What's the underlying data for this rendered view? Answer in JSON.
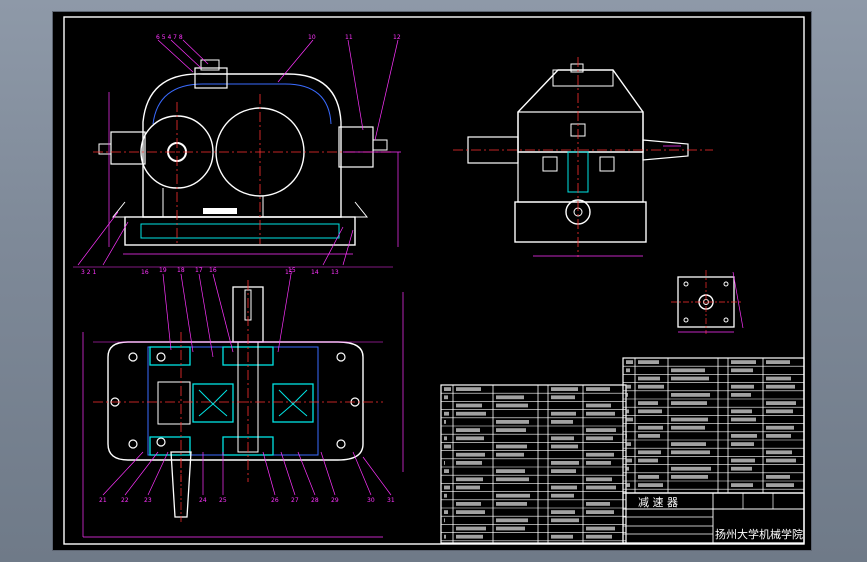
{
  "title_block": {
    "product_name": "减 速 器",
    "institution": "扬州大学机械学院"
  },
  "balloons": {
    "front_top_group": "6 5 4 7 8",
    "front_top_a": "10",
    "front_top_b": "11",
    "front_top_c": "12",
    "front_bottom_left": "3 2 1",
    "front_bottom_a": "16",
    "front_bottom_b": "15",
    "front_bottom_c": "14",
    "front_bottom_d": "13",
    "plan_top": [
      "19",
      "18",
      "17",
      "16",
      "15"
    ],
    "plan_bottom": [
      "21",
      "22",
      "23",
      "24",
      "25",
      "26",
      "27",
      "28",
      "29",
      "30",
      "31"
    ]
  },
  "colors": {
    "outline": "#ffffff",
    "centerline": "#ff3030",
    "dimension": "#ff33ff",
    "hidden": "#3a6bff",
    "section": "#00e5e5",
    "accent": "#ffff00",
    "green": "#33ff33"
  }
}
